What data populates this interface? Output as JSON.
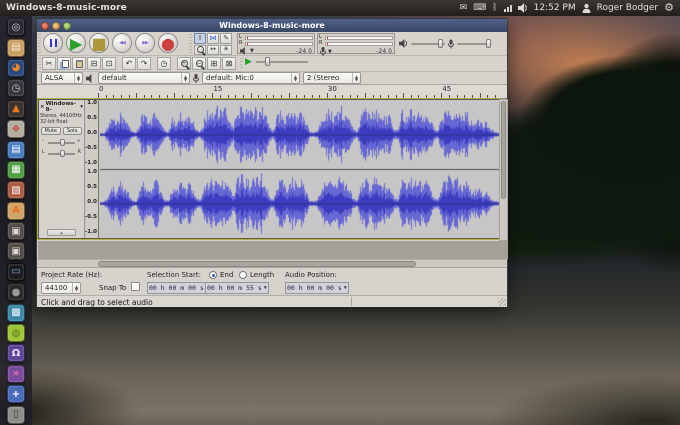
{
  "panel": {
    "window_title": "Windows-8-music-more",
    "clock": "12:52 PM",
    "username": "Roger Bodger",
    "icons": [
      "mail",
      "keyboard",
      "bluetooth",
      "network",
      "volume",
      "user",
      "settings-gear"
    ]
  },
  "launcher": {
    "items": [
      {
        "name": "dash-home",
        "bg": "#2b2733",
        "glyph": "◎",
        "fg": "#d8d4cf"
      },
      {
        "name": "files",
        "bg": "#c9a062",
        "glyph": "▤",
        "fg": "#f5ead2"
      },
      {
        "name": "firefox",
        "bg": "#29497c",
        "glyph": "◕",
        "fg": "#e8862c"
      },
      {
        "name": "clock-app",
        "bg": "#36363a",
        "glyph": "◷",
        "fg": "#cfcfcf"
      },
      {
        "name": "vlc",
        "bg": "#3a3230",
        "glyph": "▲",
        "fg": "#e87a1e"
      },
      {
        "name": "photos",
        "bg": "#b4ae9f",
        "glyph": "❖",
        "fg": "#c85050"
      },
      {
        "name": "libreoffice-writer",
        "bg": "#4a7ec0",
        "glyph": "▤",
        "fg": "#ffffff"
      },
      {
        "name": "libreoffice-calc",
        "bg": "#4f9e43",
        "glyph": "▦",
        "fg": "#ffffff"
      },
      {
        "name": "libreoffice-impress",
        "bg": "#a85b42",
        "glyph": "▧",
        "fg": "#ffffff"
      },
      {
        "name": "software-center",
        "bg": "#cfa368",
        "glyph": "A",
        "fg": "#e8742c"
      },
      {
        "name": "screenshot-tool",
        "bg": "#504c47",
        "glyph": "▣",
        "fg": "#d8d8d8"
      },
      {
        "name": "screencast-tool",
        "bg": "#504c47",
        "glyph": "▣",
        "fg": "#d8d8d8"
      },
      {
        "name": "image-viewer",
        "bg": "#1c1c1e",
        "glyph": "▭",
        "fg": "#7fa8d8"
      },
      {
        "name": "webcam-app",
        "bg": "#2a2a2c",
        "glyph": "●",
        "fg": "#999999"
      },
      {
        "name": "video-editor",
        "bg": "#3e87a6",
        "glyph": "▩",
        "fg": "#eaf5f8"
      },
      {
        "name": "ubuntu-one",
        "bg": "#9cc437",
        "glyph": "◍",
        "fg": "#5c7a1c"
      },
      {
        "name": "music-app",
        "bg": "#5f4496",
        "glyph": "Ω",
        "fg": "#eae2f8"
      },
      {
        "name": "podcast-app",
        "bg": "#7a4a9e",
        "glyph": "»",
        "fg": "#e87aaa"
      },
      {
        "name": "installer",
        "bg": "#4a6ab8",
        "glyph": "+",
        "fg": "#ffffff"
      },
      {
        "name": "archive-manager",
        "bg": "#908e89",
        "glyph": "▯",
        "fg": "#3a3a3a"
      }
    ]
  },
  "audacity": {
    "title": "Windows-8-music-more",
    "transport_buttons": [
      {
        "name": "pause",
        "shape": "pause",
        "color": "#3434cc"
      },
      {
        "name": "play",
        "glyph": "▶",
        "color": "#2ba12b"
      },
      {
        "name": "stop",
        "glyph": "■",
        "color": "#ad983c"
      },
      {
        "name": "skip-start",
        "glyph": "◀◀",
        "color": "#8a6fd0"
      },
      {
        "name": "skip-end",
        "glyph": "▶▶",
        "color": "#8a6fd0"
      },
      {
        "name": "record",
        "glyph": "●",
        "color": "#cc4040"
      }
    ],
    "tool_buttons": [
      {
        "name": "selection-tool",
        "glyph": "Ι",
        "color": "#222222",
        "active": true
      },
      {
        "name": "envelope-tool",
        "glyph": "⋈",
        "color": "#3c5fd0"
      },
      {
        "name": "draw-tool",
        "glyph": "✎",
        "color": "#444444"
      },
      {
        "name": "zoom-tool",
        "shape": "mag",
        "color": "#333333"
      },
      {
        "name": "time-shift-tool",
        "glyph": "↔",
        "color": "#333333"
      },
      {
        "name": "multi-tool",
        "glyph": "✳",
        "color": "#333333"
      }
    ],
    "edit_buttons": [
      {
        "name": "cut",
        "glyph": "✂"
      },
      {
        "name": "copy",
        "shape": "copy"
      },
      {
        "name": "paste",
        "shape": "paste"
      },
      {
        "name": "trim",
        "glyph": "⊟"
      },
      {
        "name": "silence",
        "glyph": "⊡"
      },
      {
        "name": "undo",
        "glyph": "↶"
      },
      {
        "name": "redo",
        "glyph": "↷"
      },
      {
        "name": "sync-lock",
        "glyph": "◷"
      },
      {
        "name": "zoom-in",
        "shape": "mag-plus"
      },
      {
        "name": "zoom-out",
        "shape": "mag-minus"
      },
      {
        "name": "fit-selection",
        "glyph": "⊞"
      },
      {
        "name": "fit-project",
        "glyph": "⊠"
      }
    ],
    "meters": {
      "left": "L",
      "right": "R",
      "neg": "-24",
      "zero": "0"
    },
    "device": {
      "host": "ALSA",
      "playback": "default",
      "recording": "default: Mic:0",
      "channels": "2 (Stereo"
    },
    "timeline": {
      "labels": [
        "0",
        "15",
        "30",
        "45"
      ],
      "seconds_per_label": 15,
      "pixels_per_second": 7.63
    },
    "track": {
      "close": "×",
      "name": "Windows-8-",
      "info_line1": "Stereo, 44100Hz",
      "info_line2": "32-bit float",
      "mute_label": "Mute",
      "solo_label": "Solo",
      "gain_minus": "-",
      "gain_plus": "+",
      "pan_left": "L",
      "pan_right": "R",
      "scale_labels": [
        "1.0",
        "0.5",
        "0.0",
        "-0.5",
        "-1.0"
      ]
    },
    "selection_bar": {
      "project_rate_label": "Project Rate (Hz):",
      "project_rate": "44100",
      "snap_label": "Snap To",
      "snap_checked": false,
      "selection_start_label": "Selection Start:",
      "end_label": "End",
      "length_label": "Length",
      "end_selected": true,
      "audio_position_label": "Audio Position:",
      "selection_start_value": "00 h 00 m 00 s",
      "selection_end_value": "00 h 00 m 55 s",
      "audio_position_value": "00 h 00 m 00 s"
    },
    "status_bar": {
      "message": "Click and drag to select audio"
    },
    "waveform": {
      "color_outer": "#6868d4",
      "color_inner": "#3c3cc0",
      "center_line": "#2c2c86",
      "background": "#c6c6c6",
      "envelope": [
        5,
        6,
        30,
        55,
        40,
        70,
        50,
        35,
        10,
        8,
        50,
        75,
        45,
        60,
        80,
        40,
        12,
        10,
        55,
        40,
        70,
        50,
        65,
        45,
        15,
        12,
        60,
        85,
        70,
        90,
        75,
        85,
        60,
        20,
        80,
        95,
        85,
        70,
        90,
        80,
        95,
        75,
        25,
        15,
        60,
        80,
        55,
        70,
        85,
        60,
        75,
        50,
        10,
        8,
        12,
        55,
        70,
        85,
        60,
        75,
        90,
        65,
        50,
        15,
        12,
        70,
        85,
        60,
        90,
        75,
        80,
        55,
        70,
        20,
        15,
        80,
        60,
        90,
        70,
        85,
        65,
        75,
        55,
        18,
        14,
        65,
        80,
        95,
        70,
        85,
        60,
        75,
        50,
        40,
        55,
        35,
        45,
        20,
        10,
        6
      ]
    }
  }
}
